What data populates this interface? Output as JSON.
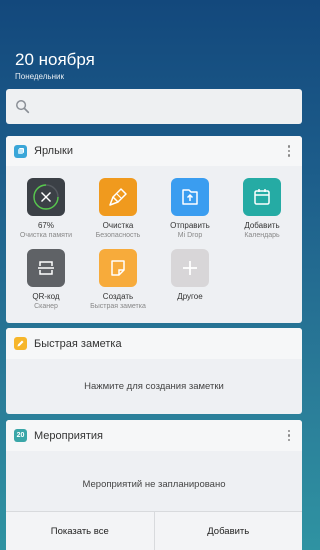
{
  "header": {
    "date": "20 ноября",
    "weekday": "Понедельник"
  },
  "search": {
    "icon": "search-icon"
  },
  "shortcuts": {
    "title": "Ярлыки",
    "items": [
      {
        "label": "67%",
        "sub": "Очистка памяти",
        "color": "#3b4046",
        "icon": "memory-clean-icon"
      },
      {
        "label": "Очистка",
        "sub": "Безопасность",
        "color": "#f09a1e",
        "icon": "broom-icon"
      },
      {
        "label": "Отправить",
        "sub": "Mi Drop",
        "color": "#3a9df0",
        "icon": "upload-icon"
      },
      {
        "label": "Добавить",
        "sub": "Календарь",
        "color": "#25aba4",
        "icon": "calendar-icon"
      },
      {
        "label": "QR-код",
        "sub": "Сканер",
        "color": "#5f6266",
        "icon": "scanner-icon"
      },
      {
        "label": "Создать",
        "sub": "Быстрая заметка",
        "color": "#f7ab3b",
        "icon": "note-icon"
      },
      {
        "label": "Другое",
        "sub": "",
        "color": "#d8d6d8",
        "icon": "plus-icon"
      }
    ]
  },
  "note": {
    "title": "Быстрая заметка",
    "hint": "Нажмите для создания заметки"
  },
  "events": {
    "title": "Мероприятия",
    "day": "20",
    "empty": "Мероприятий не запланировано",
    "show_all": "Показать все",
    "add": "Добавить"
  }
}
